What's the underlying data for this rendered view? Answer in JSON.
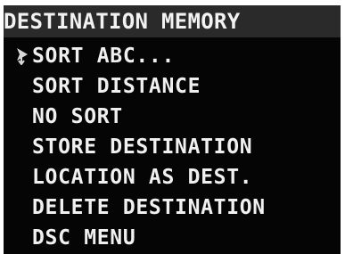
{
  "header": {
    "title": "DESTINATION MEMORY"
  },
  "menu": {
    "items": [
      {
        "label": "SORT ABC..."
      },
      {
        "label": "SORT DISTANCE"
      },
      {
        "label": "NO SORT"
      },
      {
        "label": "STORE DESTINATION"
      },
      {
        "label": "LOCATION AS DEST."
      },
      {
        "label": "DELETE DESTINATION"
      },
      {
        "label": "DSC MENU"
      }
    ],
    "selected_index": 0,
    "cursor_icon": "selection-arrow-icon"
  },
  "colors": {
    "screen_background": "#050505",
    "title_background": "#2a2a2a",
    "text": "#f0f0f0"
  }
}
